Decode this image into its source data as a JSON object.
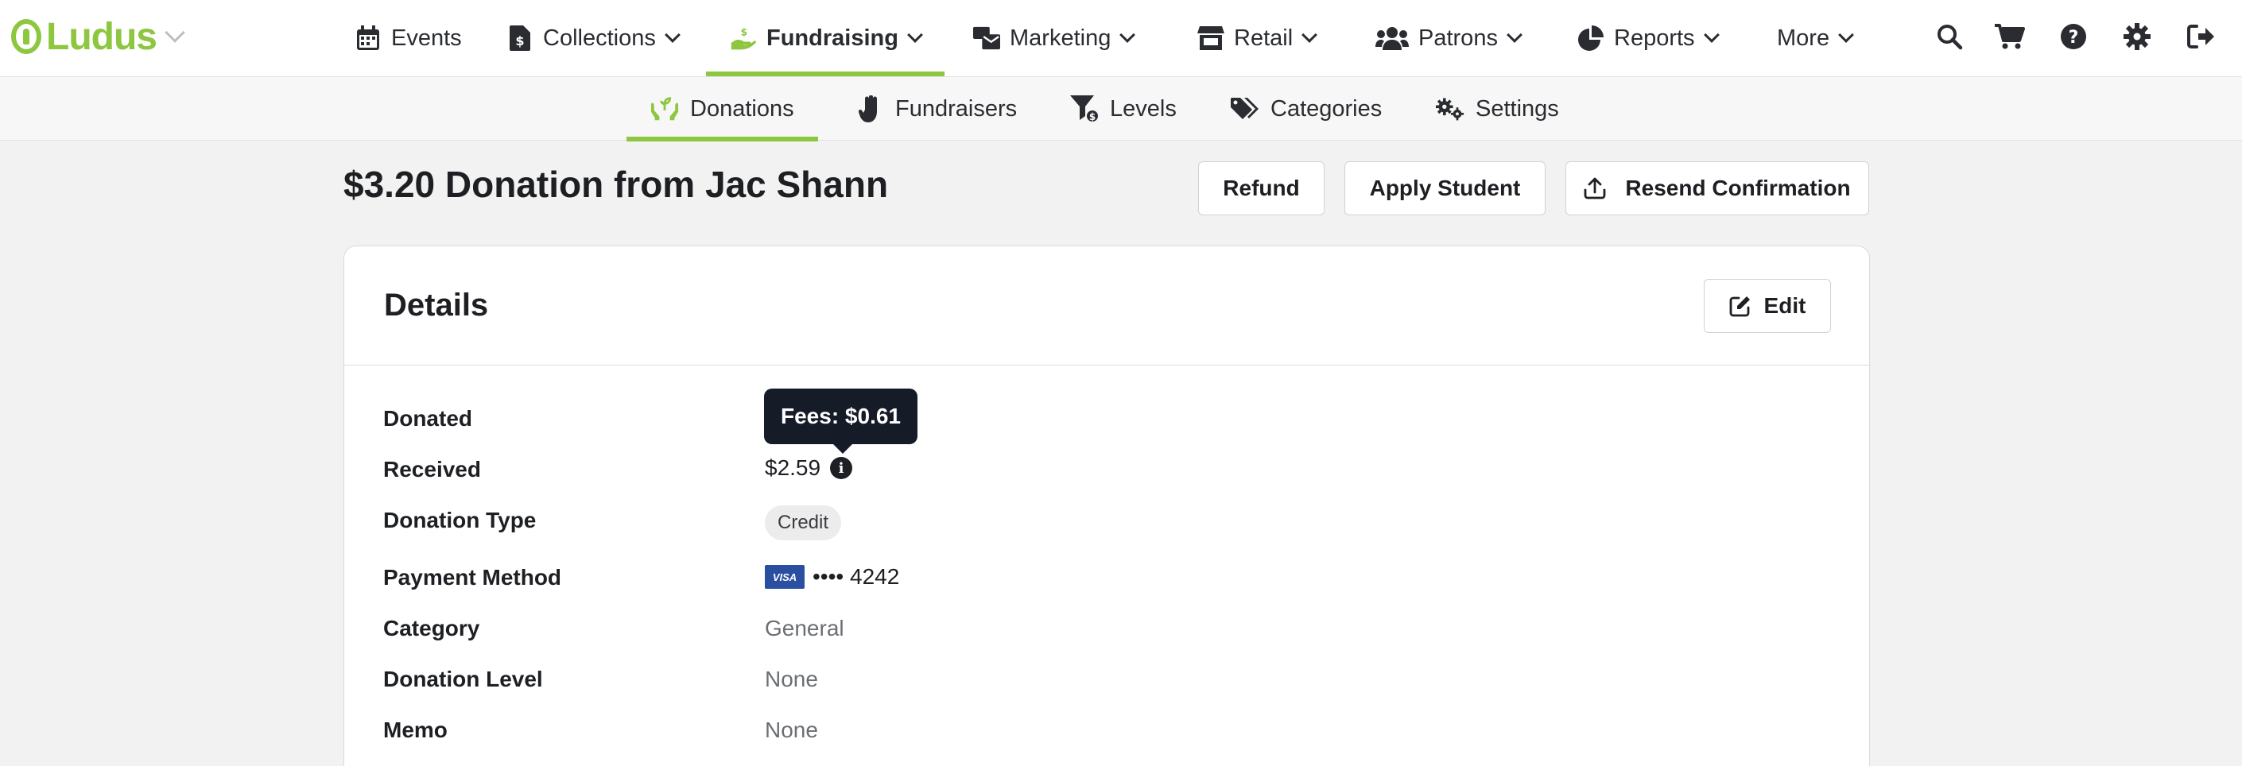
{
  "app": {
    "logo_text": "Ludus",
    "brand_color": "#8dc63f"
  },
  "topnav": {
    "items": [
      {
        "label": "Events",
        "icon": "calendar-icon"
      },
      {
        "label": "Collections",
        "icon": "file-dollar-icon"
      },
      {
        "label": "Fundraising",
        "icon": "hand-holding-dollar-icon",
        "active": true
      },
      {
        "label": "Marketing",
        "icon": "mail-bulk-icon"
      },
      {
        "label": "Retail",
        "icon": "store-icon"
      },
      {
        "label": "Patrons",
        "icon": "users-icon"
      },
      {
        "label": "Reports",
        "icon": "chart-pie-icon"
      },
      {
        "label": "More"
      }
    ],
    "utilities": [
      "search-icon",
      "cart-icon",
      "help-icon",
      "gear-icon",
      "logout-icon"
    ]
  },
  "subnav": {
    "items": [
      {
        "label": "Donations",
        "icon": "seedling-hands-icon",
        "active": true
      },
      {
        "label": "Fundraisers",
        "icon": "hand-icon"
      },
      {
        "label": "Levels",
        "icon": "filter-dollar-icon"
      },
      {
        "label": "Categories",
        "icon": "tags-icon"
      },
      {
        "label": "Settings",
        "icon": "cogs-icon"
      }
    ]
  },
  "page": {
    "title": "$3.20 Donation from Jac Shann",
    "actions": {
      "refund": "Refund",
      "apply_student": "Apply Student",
      "resend_confirmation": "Resend Confirmation"
    }
  },
  "details": {
    "title": "Details",
    "edit_label": "Edit",
    "tooltip": "Fees: $0.61",
    "rows": [
      {
        "label": "Donated",
        "value": ""
      },
      {
        "label": "Received",
        "value": "$2.59"
      },
      {
        "label": "Donation Type",
        "value": "Credit"
      },
      {
        "label": "Payment Method",
        "card_brand": "VISA",
        "value": "•••• 4242"
      },
      {
        "label": "Category",
        "value": "General"
      },
      {
        "label": "Donation Level",
        "value": "None"
      },
      {
        "label": "Memo",
        "value": "None"
      }
    ]
  }
}
